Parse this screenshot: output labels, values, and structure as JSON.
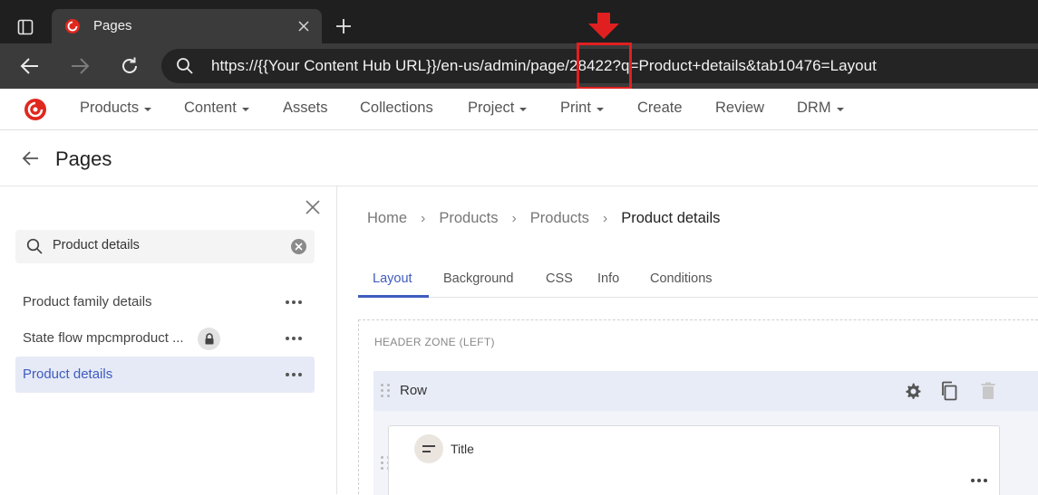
{
  "browser": {
    "tab_title": "Pages",
    "url": "https://{{Your Content Hub URL}}/en-us/admin/page/28422?q=Product+details&tab10476=Layout",
    "url_display": "https://{{Your Content Hub URL}}/en-us/admin/page/28422?q=Product+details&tab10476=Layout"
  },
  "app_nav": {
    "items": [
      {
        "label": "Products",
        "dropdown": true
      },
      {
        "label": "Content",
        "dropdown": true
      },
      {
        "label": "Assets",
        "dropdown": false
      },
      {
        "label": "Collections",
        "dropdown": false
      },
      {
        "label": "Project",
        "dropdown": true
      },
      {
        "label": "Print",
        "dropdown": true
      },
      {
        "label": "Create",
        "dropdown": false
      },
      {
        "label": "Review",
        "dropdown": false
      },
      {
        "label": "DRM",
        "dropdown": true
      }
    ]
  },
  "page_header": {
    "title": "Pages"
  },
  "sidebar": {
    "search_value": "Product details",
    "items": [
      {
        "label": "Product family details",
        "locked": false,
        "active": false
      },
      {
        "label": "State flow mpcmproduct ...",
        "locked": true,
        "active": false
      },
      {
        "label": "Product details",
        "locked": false,
        "active": true
      }
    ]
  },
  "main": {
    "breadcrumb": [
      "Home",
      "Products",
      "Products",
      "Product details"
    ],
    "tabs": [
      "Layout",
      "Background",
      "CSS",
      "Info",
      "Conditions"
    ],
    "active_tab": "Layout",
    "zone_label": "HEADER ZONE (LEFT)",
    "row_label": "Row",
    "component_label": "Title"
  },
  "colors": {
    "accent": "#3f5bbf",
    "highlight": "#e02020",
    "brand": "#e0281e"
  },
  "icons": [
    "sidebar-toggle-icon",
    "browser-favicon-icon",
    "close-icon",
    "plus-icon",
    "back-icon",
    "forward-icon",
    "reload-icon",
    "search-icon",
    "sitecore-logo-icon",
    "arrow-left-icon",
    "lock-icon",
    "more-icon",
    "gear-icon",
    "copy-icon",
    "trash-icon",
    "drag-handle-icon",
    "text-lines-icon",
    "red-down-arrow-icon"
  ]
}
